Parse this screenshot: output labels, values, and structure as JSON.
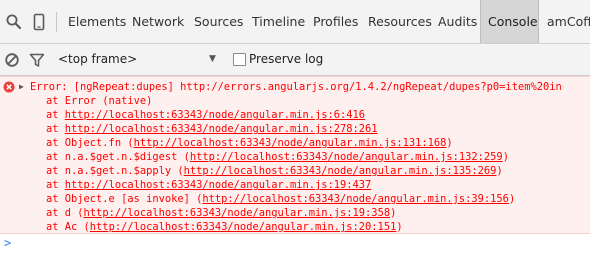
{
  "toolbar": {
    "tabs": [
      {
        "label": "Elements",
        "active": false
      },
      {
        "label": "Network",
        "active": false
      },
      {
        "label": "Sources",
        "active": false
      },
      {
        "label": "Timeline",
        "active": false
      },
      {
        "label": "Profiles",
        "active": false
      },
      {
        "label": "Resources",
        "active": false
      },
      {
        "label": "Audits",
        "active": false
      },
      {
        "label": "Console",
        "active": true
      },
      {
        "label": "amCoffee",
        "active": false
      }
    ]
  },
  "filter_bar": {
    "frame_select": "<top frame>",
    "preserve_log_label": "Preserve log",
    "preserve_log_checked": false
  },
  "console": {
    "error": {
      "header_text": "Error: [ngRepeat:dupes] ",
      "header_link": "http://errors.angularjs.org/1.4.2/ngRepeat/dupes?p0=item%20in",
      "stack": [
        {
          "prefix": "at Error (native)",
          "link": "",
          "suffix": ""
        },
        {
          "prefix": "at ",
          "link": "http://localhost:63343/node/angular.min.js:6:416",
          "suffix": ""
        },
        {
          "prefix": "at ",
          "link": "http://localhost:63343/node/angular.min.js:278:261",
          "suffix": ""
        },
        {
          "prefix": "at Object.fn (",
          "link": "http://localhost:63343/node/angular.min.js:131:168",
          "suffix": ")"
        },
        {
          "prefix": "at n.a.$get.n.$digest (",
          "link": "http://localhost:63343/node/angular.min.js:132:259",
          "suffix": ")"
        },
        {
          "prefix": "at n.a.$get.n.$apply (",
          "link": "http://localhost:63343/node/angular.min.js:135:269",
          "suffix": ")"
        },
        {
          "prefix": "at ",
          "link": "http://localhost:63343/node/angular.min.js:19:437",
          "suffix": ""
        },
        {
          "prefix": "at Object.e [as invoke] (",
          "link": "http://localhost:63343/node/angular.min.js:39:156",
          "suffix": ")"
        },
        {
          "prefix": "at d (",
          "link": "http://localhost:63343/node/angular.min.js:19:358",
          "suffix": ")"
        },
        {
          "prefix": "at Ac (",
          "link": "http://localhost:63343/node/angular.min.js:20:151",
          "suffix": ")"
        }
      ]
    },
    "prompt_symbol": ">"
  },
  "colors": {
    "error_text": "#ff0000",
    "error_background": "#fff0f0",
    "error_icon": "#e8403b",
    "prompt": "#367cf1",
    "active_tab_background": "#d6d6d6",
    "toolbar_background": "#f3f3f3"
  },
  "icons": {
    "inspect": "magnifier-icon",
    "device": "mobile-device-icon",
    "clear": "clear-console-icon",
    "filter": "filter-icon",
    "error": "error-icon",
    "disclosure": "disclosure-triangle-icon"
  }
}
